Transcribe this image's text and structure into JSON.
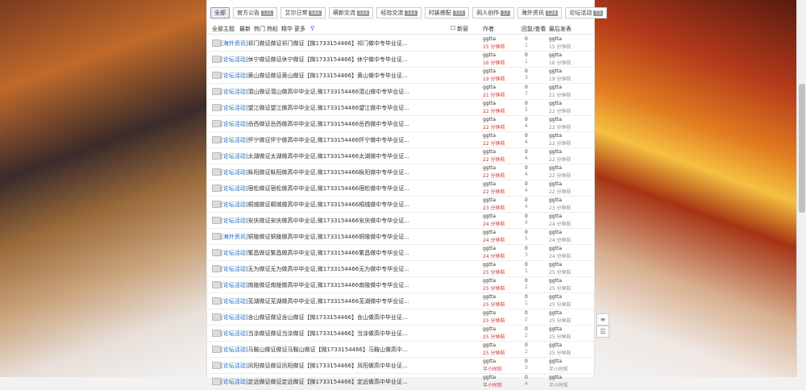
{
  "tabs": [
    {
      "label": "全部",
      "count": ""
    },
    {
      "label": "官方公告",
      "count": "131"
    },
    {
      "label": "艾尔日常",
      "count": "584"
    },
    {
      "label": "萌新交流",
      "count": "164"
    },
    {
      "label": "经验交流",
      "count": "144"
    },
    {
      "label": "时装搭配",
      "count": "335"
    },
    {
      "label": "同人创作",
      "count": "17"
    },
    {
      "label": "海外资讯",
      "count": "128"
    },
    {
      "label": "论坛活动",
      "count": "73"
    }
  ],
  "subbar": {
    "all": "全部主题",
    "latest": "最新",
    "hot": "热门",
    "hotpost": "热帖",
    "featured": "精华",
    "more": "更多",
    "new": "新窗",
    "author": "作者",
    "reply_view": "回复/查看",
    "last": "最后发表"
  },
  "rows": [
    {
      "tag": "[海外资讯]",
      "text": "祁门做证做证祁门做证【微1733154466】祁门做中专毕业证...",
      "author": "ggtta",
      "time": "15 分钟前",
      "replies": "0",
      "views": "1",
      "lauthor": "ggtta",
      "ltime": "15 分钟前"
    },
    {
      "tag": "[论坛活动]",
      "text": "休宁做证做证休宁做证【微1733154466】休宁做中专毕业证...",
      "author": "ggtta",
      "time": "16 分钟前",
      "replies": "0",
      "views": "1",
      "lauthor": "ggtta",
      "ltime": "16 分钟前"
    },
    {
      "tag": "[论坛活动]",
      "text": "黄山做证做证黄山做证【微1733154466】黄山做中专毕业证...",
      "author": "ggtta",
      "time": "19 分钟前",
      "replies": "0",
      "views": "3",
      "lauthor": "ggtta",
      "ltime": "19 分钟前"
    },
    {
      "tag": "[论坛活动]",
      "text": "潜山做证潜山做高中毕业证,微1733154466潜山做中专毕业证...",
      "author": "ggtta",
      "time": "21 分钟前",
      "replies": "0",
      "views": "7",
      "lauthor": "ggtta",
      "ltime": "21 分钟前"
    },
    {
      "tag": "[论坛活动]",
      "text": "望江做证望江做高中毕业证,微1733154466望江做中专毕业证...",
      "author": "ggtta",
      "time": "22 分钟前",
      "replies": "0",
      "views": "5",
      "lauthor": "ggtta",
      "ltime": "22 分钟前"
    },
    {
      "tag": "[论坛活动]",
      "text": "岳西做证岳西做高中毕业证,微1733154466岳西做中专毕业证...",
      "author": "ggtta",
      "time": "22 分钟前",
      "replies": "0",
      "views": "4",
      "lauthor": "ggtta",
      "ltime": "22 分钟前"
    },
    {
      "tag": "[论坛活动]",
      "text": "怀宁做证怀宁做高中毕业证,微1733154466怀宁做中专毕业证...",
      "author": "ggtta",
      "time": "22 分钟前",
      "replies": "0",
      "views": "4",
      "lauthor": "ggtta",
      "ltime": "22 分钟前"
    },
    {
      "tag": "[论坛活动]",
      "text": "太湖做证太湖做高中毕业证,微1733154466太湖做中专毕业证...",
      "author": "ggtta",
      "time": "22 分钟前",
      "replies": "0",
      "views": "4",
      "lauthor": "ggtta",
      "ltime": "22 分钟前"
    },
    {
      "tag": "[论坛活动]",
      "text": "枞阳做证枞阳做高中毕业证,微1733154466枞阳做中专毕业证...",
      "author": "ggtta",
      "time": "22 分钟前",
      "replies": "0",
      "views": "4",
      "lauthor": "ggtta",
      "ltime": "22 分钟前"
    },
    {
      "tag": "[论坛活动]",
      "text": "宿松做证宿松做高中毕业证,微1733154466宿松做中专毕业证...",
      "author": "ggtta",
      "time": "22 分钟前",
      "replies": "0",
      "views": "4",
      "lauthor": "ggtta",
      "ltime": "22 分钟前"
    },
    {
      "tag": "[论坛活动]",
      "text": "桐城做证桐城做高中毕业证,微1733154466桐城做中专毕业证...",
      "author": "ggtta",
      "time": "23 分钟前",
      "replies": "0",
      "views": "4",
      "lauthor": "ggtta",
      "ltime": "23 分钟前"
    },
    {
      "tag": "[论坛活动]",
      "text": "安庆做证安庆做高中毕业证,微1733154466安庆做中专毕业证...",
      "author": "ggtta",
      "time": "24 分钟前",
      "replies": "0",
      "views": "4",
      "lauthor": "ggtta",
      "ltime": "24 分钟前"
    },
    {
      "tag": "[海外资讯]",
      "text": "铜陵做证铜陵做高中毕业证,微1733154466铜陵做中专毕业证...",
      "author": "ggtta",
      "time": "24 分钟前",
      "replies": "0",
      "views": "5",
      "lauthor": "ggtta",
      "ltime": "24 分钟前"
    },
    {
      "tag": "[论坛活动]",
      "text": "繁昌做证繁昌做高中毕业证,微1733154466繁昌做中专毕业证...",
      "author": "ggtta",
      "time": "24 分钟前",
      "replies": "0",
      "views": "3",
      "lauthor": "ggtta",
      "ltime": "24 分钟前"
    },
    {
      "tag": "[论坛活动]",
      "text": "无为做证无为做高中毕业证,微1733154466无为做中专毕业证...",
      "author": "ggtta",
      "time": "25 分钟前",
      "replies": "0",
      "views": "1",
      "lauthor": "ggtta",
      "ltime": "25 分钟前"
    },
    {
      "tag": "[论坛活动]",
      "text": "南陵做证南陵做高中毕业证,微1733154466南陵做中专毕业证...",
      "author": "ggtta",
      "time": "25 分钟前",
      "replies": "0",
      "views": "2",
      "lauthor": "ggtta",
      "ltime": "25 分钟前"
    },
    {
      "tag": "[论坛活动]",
      "text": "芜湖做证芜湖做高中毕业证,微1733154466芜湖做中专毕业证...",
      "author": "ggtta",
      "time": "25 分钟前",
      "replies": "0",
      "views": "1",
      "lauthor": "ggtta",
      "ltime": "25 分钟前"
    },
    {
      "tag": "[论坛活动]",
      "text": "含山做证做证含山做证【微1733154466】含山做高中毕业证...",
      "author": "ggtta",
      "time": "25 分钟前",
      "replies": "0",
      "views": "2",
      "lauthor": "ggtta",
      "ltime": "25 分钟前"
    },
    {
      "tag": "[论坛活动]",
      "text": "当涂做证做证当涂做证【微1733154466】当涂做高中毕业证...",
      "author": "ggtta",
      "time": "25 分钟前",
      "replies": "0",
      "views": "2",
      "lauthor": "ggtta",
      "ltime": "25 分钟前"
    },
    {
      "tag": "[论坛活动]",
      "text": "马鞍山做证做证马鞍山做证【微1733154466】马鞍山做高中...",
      "author": "ggtta",
      "time": "25 分钟前",
      "replies": "0",
      "views": "2",
      "lauthor": "ggtta",
      "ltime": "25 分钟前"
    },
    {
      "tag": "[论坛活动]",
      "text": "凤阳做证做证凤阳做证【微1733154466】凤阳做高中毕业证...",
      "author": "ggtta",
      "time": "半小时前",
      "replies": "0",
      "views": "3",
      "lauthor": "ggtta",
      "ltime": "半小时前"
    },
    {
      "tag": "[论坛活动]",
      "text": "定远做证做证定远做证【微1733154466】定远做高中毕业证...",
      "author": "ggtta",
      "time": "半小时前",
      "replies": "0",
      "views": "4",
      "lauthor": "ggtta",
      "ltime": "半小时前"
    }
  ],
  "float": {
    "top": "≡",
    "list": "☰"
  }
}
